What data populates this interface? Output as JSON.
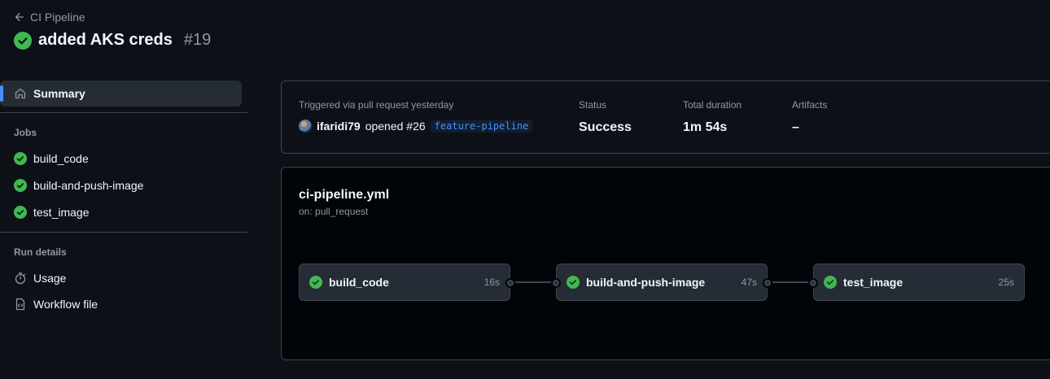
{
  "header": {
    "back_label": "CI Pipeline",
    "title": "added AKS creds",
    "run_number": "#19"
  },
  "sidebar": {
    "summary_label": "Summary",
    "jobs_heading": "Jobs",
    "jobs": [
      {
        "label": "build_code",
        "status": "success"
      },
      {
        "label": "build-and-push-image",
        "status": "success"
      },
      {
        "label": "test_image",
        "status": "success"
      }
    ],
    "run_details_heading": "Run details",
    "run_details": [
      {
        "label": "Usage",
        "icon": "stopwatch-icon"
      },
      {
        "label": "Workflow file",
        "icon": "file-code-icon"
      }
    ]
  },
  "summary": {
    "trigger_heading": "Triggered via pull request yesterday",
    "actor": "ifaridi79",
    "action": "opened #26",
    "branch": "feature-pipeline",
    "status_heading": "Status",
    "status_value": "Success",
    "duration_heading": "Total duration",
    "duration_value": "1m 54s",
    "artifacts_heading": "Artifacts",
    "artifacts_value": "–"
  },
  "workflow": {
    "file_name": "ci-pipeline.yml",
    "trigger": "on: pull_request",
    "jobs": [
      {
        "label": "build_code",
        "duration": "16s"
      },
      {
        "label": "build-and-push-image",
        "duration": "47s"
      },
      {
        "label": "test_image",
        "duration": "25s"
      }
    ]
  },
  "colors": {
    "success": "#3fb950",
    "accent": "#4493f8",
    "background": "#0d1117"
  }
}
